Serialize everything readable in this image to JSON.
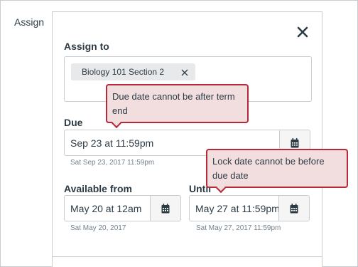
{
  "section_label": "Assign",
  "assign_to": {
    "label": "Assign to",
    "tokens": [
      {
        "label": "Biology 101 Section 2"
      }
    ]
  },
  "due": {
    "label": "Due",
    "value": "Sep 23 at 11:59pm",
    "hint": "Sat Sep 23, 2017 11:59pm"
  },
  "available_from": {
    "label": "Available from",
    "value": "May 20 at 12am",
    "hint": "Sat May 20, 2017"
  },
  "until": {
    "label": "Until",
    "value": "May 27 at 11:59pm",
    "hint": "Sat May 27, 2017 11:59pm"
  },
  "errors": {
    "due": "Due date cannot be after term end",
    "until": "Lock date cannot be before due date"
  },
  "icons": {
    "close": "close-icon",
    "calendar": "calendar-icon",
    "remove": "remove-icon"
  },
  "colors": {
    "error_border": "#b42a38",
    "error_bg": "#f2dede",
    "border": "#c7cdd1",
    "text": "#2d3b45"
  }
}
